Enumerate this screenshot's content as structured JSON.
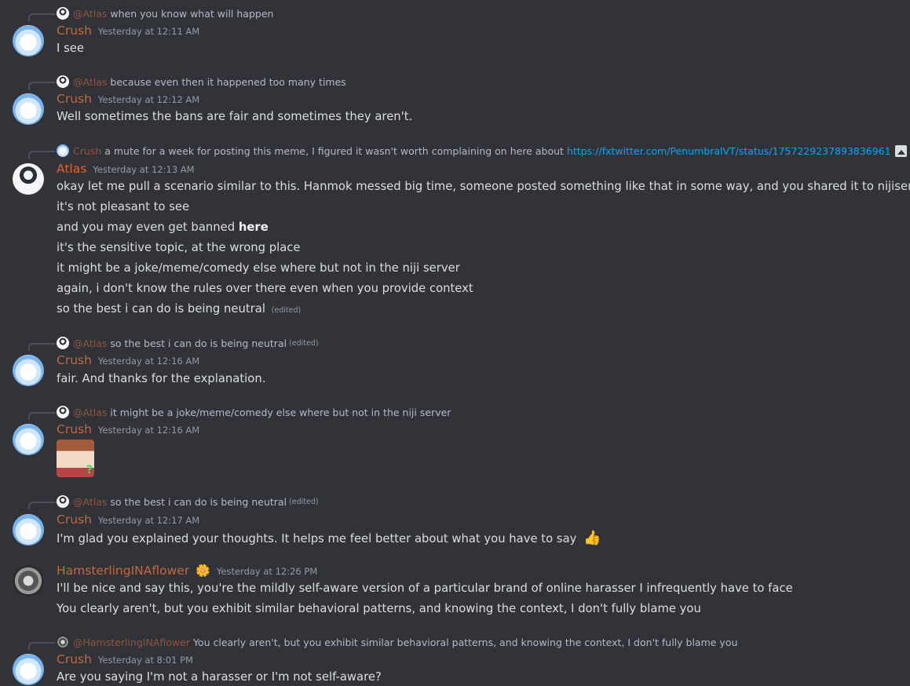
{
  "messages": [
    {
      "reply": {
        "name": "@Atlas",
        "text": "when you know what will happen"
      },
      "user": "Crush",
      "time": "Yesterday at 12:11 AM",
      "lines": [
        "I see"
      ]
    },
    {
      "reply": {
        "name": "@Atlas",
        "text": "because even then it happened too many times"
      },
      "user": "Crush",
      "time": "Yesterday at 12:12 AM",
      "lines": [
        "Well sometimes the bans are fair and sometimes they aren't."
      ]
    },
    {
      "reply": {
        "name": "Crush",
        "text": "a mute for a week for posting this meme, I figured it wasn't worth complaining on here about",
        "link": "https://fxtwitter.com/PenumbralVT/status/1757229237893836961"
      },
      "user": "Atlas",
      "time": "Yesterday at 12:13 AM",
      "lines": [
        "okay let me pull a scenario similar to this. Hanmok messed big time, someone posted something like that in some way, and you shared it to nijisenja-chat",
        "it's not pleasant to see",
        "and you may even get banned",
        "it's the sensitive topic, at the wrong place",
        "it might be a joke/meme/comedy else where but not in the niji server",
        "again, i don't know the rules over there even when you provide context",
        "so the best i can do is being neutral"
      ],
      "bold_word": "here",
      "edited": "(edited)"
    },
    {
      "reply": {
        "name": "@Atlas",
        "text": "so the best i can do is being neutral",
        "edited": "(edited)"
      },
      "user": "Crush",
      "time": "Yesterday at 12:16 AM",
      "lines": [
        "fair. And thanks for the explanation."
      ]
    },
    {
      "reply": {
        "name": "@Atlas",
        "text": "it might be a joke/meme/comedy else where but not in the niji server"
      },
      "user": "Crush",
      "time": "Yesterday at 12:16 AM",
      "sticker_mark": "?"
    },
    {
      "reply": {
        "name": "@Atlas",
        "text": "so the best i can do is being neutral",
        "edited": "(edited)"
      },
      "user": "Crush",
      "time": "Yesterday at 12:17 AM",
      "lines": [
        "I'm glad you explained your thoughts. It helps me feel better about what you have to say"
      ],
      "emoji": "👍"
    },
    {
      "user": "HamsterlingINAflower",
      "badge": "🌼",
      "time": "Yesterday at 12:26 PM",
      "lines": [
        "I'll be nice and say this, you're the mildly self-aware version of a particular brand of online harasser I infrequently have to face",
        "You clearly aren't, but you exhibit similar behavioral patterns, and knowing the context, I don't fully blame you"
      ]
    },
    {
      "reply": {
        "name": "@HamsterlingINAflower",
        "text": "You clearly aren't, but you exhibit similar behavioral patterns, and knowing the context, I don't fully blame you"
      },
      "user": "Crush",
      "time": "Yesterday at 8:01 PM",
      "lines": [
        "Are you saying I'm not a harasser or I'm not self-aware?"
      ]
    }
  ]
}
